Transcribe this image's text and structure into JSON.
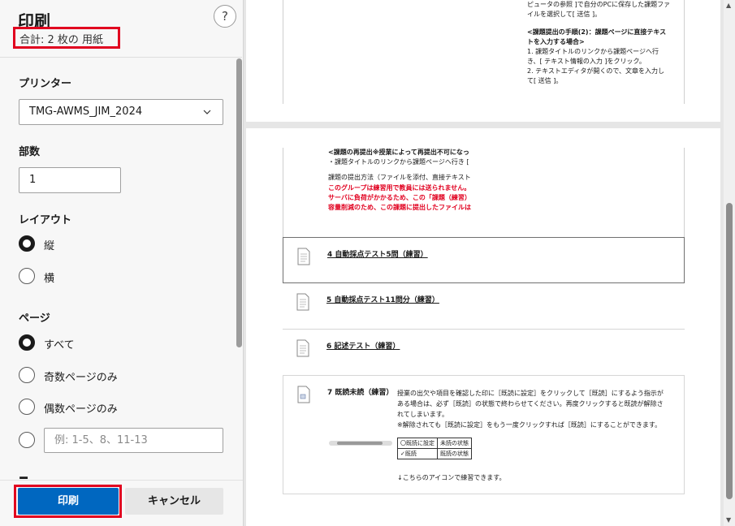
{
  "panel": {
    "title": "印刷",
    "help": "?",
    "sheets": "合計: 2 枚の 用紙",
    "printer_label": "プリンター",
    "printer_value": "TMG-AWMS_JIM_2024",
    "copies_label": "部数",
    "copies_value": "1",
    "layout_label": "レイアウト",
    "layout_options": [
      "縦",
      "横"
    ],
    "pages_label": "ページ",
    "pages_options": [
      "すべて",
      "奇数ページのみ",
      "偶数ページのみ"
    ],
    "range_placeholder": "例: 1-5、8、11-13",
    "print_button": "印刷",
    "cancel_button": "キャンセル"
  },
  "preview": {
    "page1_lines": [
      "ピュータの参照 ]で自分のPCに保存した課題ファ",
      "イルを選択して[ 送信 ]。",
      "<課題提出の手順(2)：課題ページに直接テキス",
      "トを入力する場合>",
      "1. 課題タイトルのリンクから課題ページへ行",
      "き、[ テキスト情報の入力 ]をクリック。",
      "2. テキストエディタが開くので、文章を入力し",
      "て[ 送信 ]。"
    ],
    "page2_top_lines": [
      "<課題の再提出※授業によって再提出不可になっ",
      "・課題タイトルのリンクから課題ページへ行き [",
      "課題の提出方法（ファイルを添付、直接テキスト",
      "このグループは練習用で教員には送られません。",
      "サーバに負荷がかかるため、この「課題（練習）",
      "容量削減のため、この課題に提出したファイルは"
    ],
    "items": [
      "4 自動採点テスト5問（練習）",
      "5 自動採点テスト11問分（練習）",
      "6 記述テスト（練習）",
      "7 既読未読（練習）"
    ],
    "item7_desc": [
      "授業の出欠や項目を確認した印に［既読に設定］をクリックして［既読］にするよう指示が",
      "ある場合は、必ず［既読］の状態で終わらせてください。再度クリックすると既読が解除さ",
      "れてしまいます。",
      "※解除されても［既読に設定］をもう一度クリックすれば［既読］にすることができます。"
    ],
    "table": [
      [
        "〇既読に設定",
        "未読の状態"
      ],
      [
        "✓既読",
        "既読の状態"
      ]
    ],
    "footer": "↓こちらのアイコンで練習できます。"
  }
}
